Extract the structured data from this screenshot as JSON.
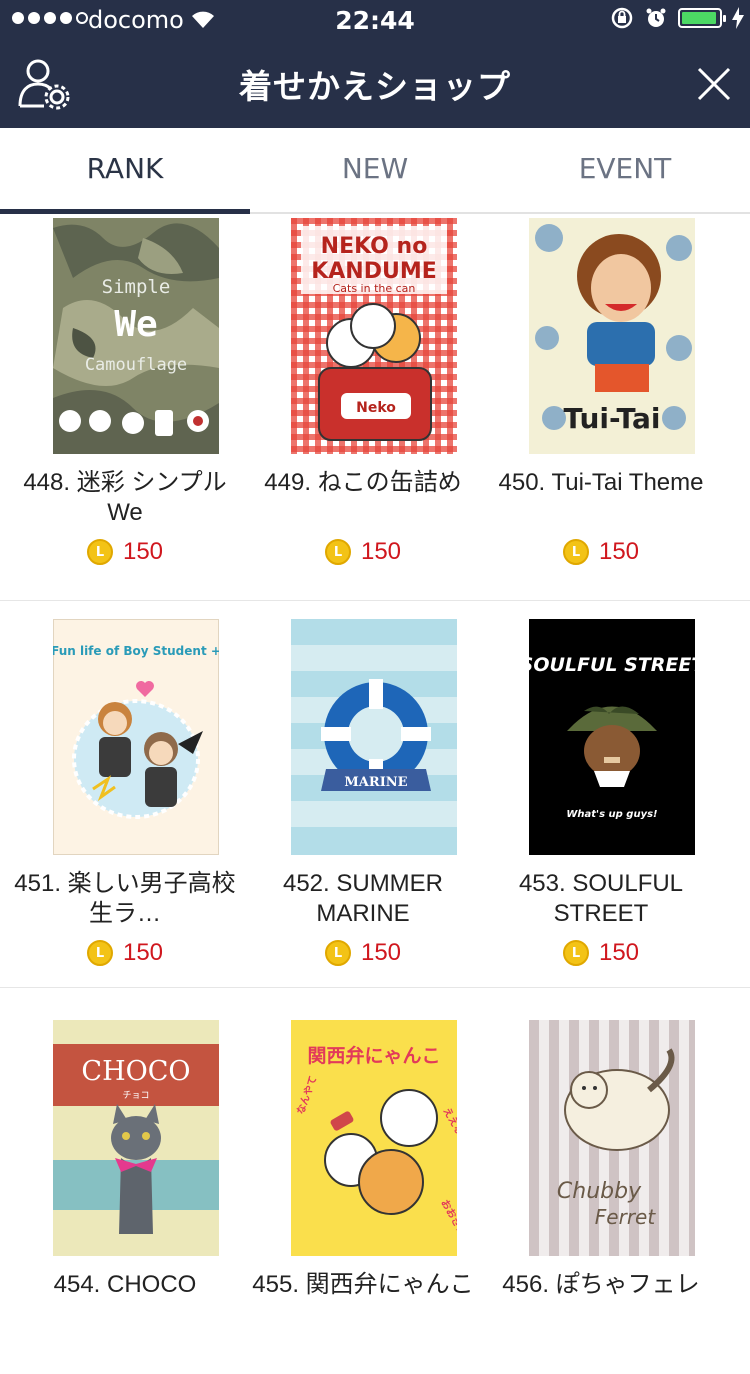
{
  "status": {
    "carrier": "docomo",
    "time": "22:44"
  },
  "header": {
    "title": "着せかえショップ"
  },
  "tabs": [
    {
      "label": "RANK",
      "active": true
    },
    {
      "label": "NEW",
      "active": false
    },
    {
      "label": "EVENT",
      "active": false
    }
  ],
  "coin_letter": "L",
  "items": [
    {
      "name": "448. 迷彩 シンプルWe",
      "price": "150",
      "art": {
        "l1": "Simple",
        "l2": "We",
        "l3": "Camouflage"
      }
    },
    {
      "name": "449. ねこの缶詰め",
      "price": "150",
      "art": {
        "l1": "NEKO no",
        "l2": "KANDUME",
        "l3": "Cats in the can",
        "l4": "Neko"
      }
    },
    {
      "name": "450. Tui-Tai Theme",
      "price": "150",
      "art": {
        "l1": "Tui-Tai"
      }
    },
    {
      "name": "451. 楽しい男子高校生ラ…",
      "price": "150",
      "art": {
        "l1": "Fun life of Boy Student +"
      }
    },
    {
      "name": "452. SUMMER MARINE",
      "price": "150",
      "art": {
        "l1": "MARINE"
      }
    },
    {
      "name": "453. SOULFUL STREET",
      "price": "150",
      "art": {
        "l1": "SOULFUL STREET",
        "l2": "What's up guys!"
      }
    },
    {
      "name": "454. CHOCO",
      "price": "150",
      "art": {
        "l1": "CHOCO",
        "l2": "チョコ"
      }
    },
    {
      "name": "455. 関西弁にゃんこ",
      "price": "150",
      "art": {
        "l1": "関西弁にゃんこ",
        "l2": "ええなぁ",
        "l3": "おおきに",
        "l4": "なんやて"
      }
    },
    {
      "name": "456. ぽちゃフェレ",
      "price": "150",
      "art": {
        "l1": "Chubby",
        "l2": "Ferret"
      }
    }
  ]
}
